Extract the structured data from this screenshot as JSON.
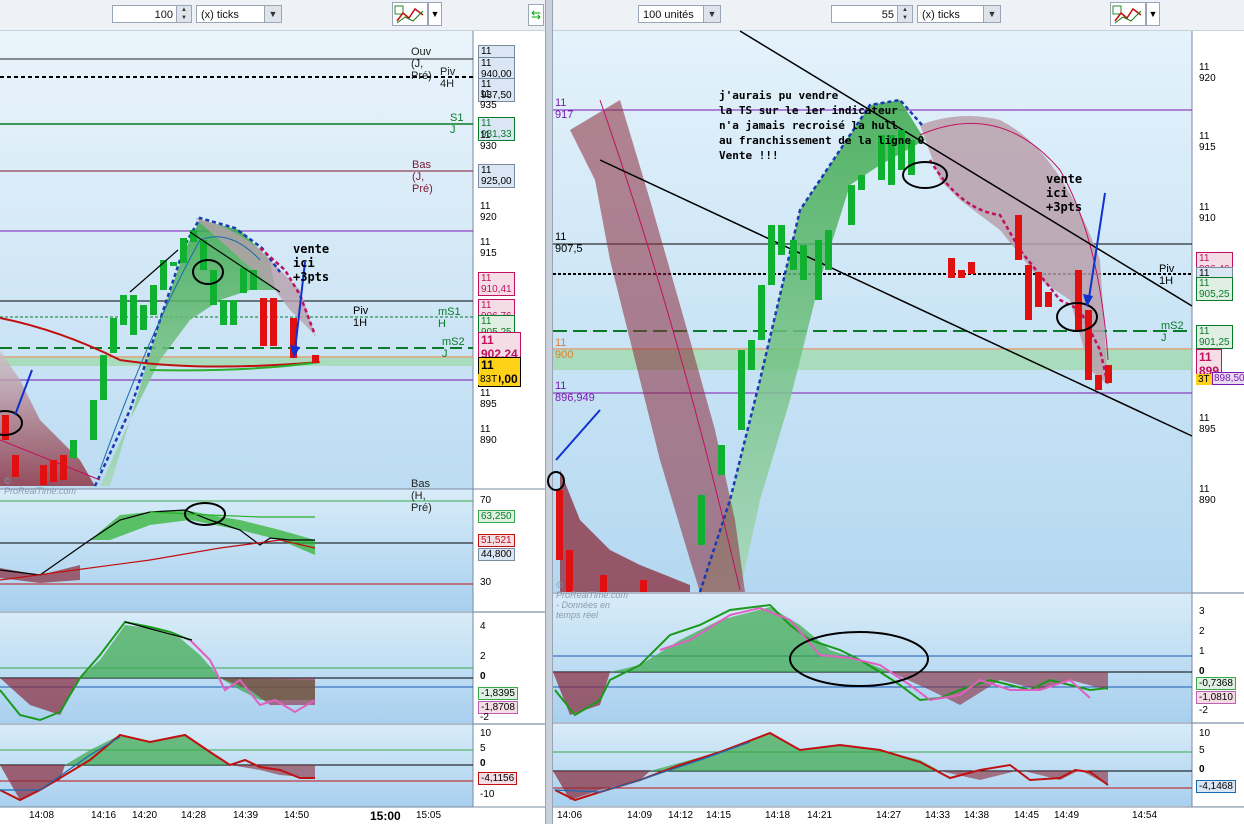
{
  "left_toolbar": {
    "quantity": "100",
    "unit": "(x) ticks"
  },
  "right_toolbar": {
    "units": "100 unités",
    "quantity": "55",
    "unit": "(x) ticks"
  },
  "left_chart": {
    "levels": [
      {
        "label": "Ouv (J, Pré)",
        "value": "11 940,00",
        "color": "#222"
      },
      {
        "label": "",
        "value": "11 940,00",
        "color": "#222"
      },
      {
        "label": "Piv 4H",
        "value": "11 937,50",
        "color": "#222"
      },
      {
        "label": "",
        "value": "11 937,50",
        "color": "#222"
      },
      {
        "label": "S1 J",
        "value": "11 931,33",
        "color": "#0a7a2a"
      },
      {
        "label": "Bas (J, Pré)",
        "value": "11 925,00",
        "color": "#7a1830"
      },
      {
        "label": "",
        "value": "11 910,41",
        "color": "#c01060"
      },
      {
        "label": "Piv 1H",
        "value": "11 906,76",
        "color": "#c01060"
      },
      {
        "label": "mS1 H",
        "value": "11 905,25",
        "color": "#0a7a2a"
      },
      {
        "label": "mS2 J",
        "value": "11 901,25",
        "color": "#0a7a2a"
      },
      {
        "label": "",
        "value": "11 902,24",
        "color": "#c01060"
      },
      {
        "label": "",
        "value": "11 899,00",
        "color": "#000"
      },
      {
        "label": "",
        "value": "83T",
        "color": "#000"
      },
      {
        "label": "Bas (H, Pré)",
        "value": "",
        "color": "#222"
      }
    ],
    "y_ticks": [
      "11 935",
      "11 930",
      "11 920",
      "11 915",
      "11 895",
      "11 890"
    ],
    "annotation": "vente ici +3pts",
    "ind1": {
      "ticks": [
        "70",
        "30"
      ],
      "values": [
        "63,250",
        "51,521",
        "44,800"
      ]
    },
    "ind2": {
      "ticks": [
        "4",
        "2",
        "0",
        "-2"
      ],
      "values": [
        "-1,8395",
        "-1,8708"
      ]
    },
    "ind3": {
      "ticks": [
        "10",
        "5",
        "0",
        "-5",
        "-10"
      ],
      "values": [
        "-4,1156"
      ]
    },
    "x_labels": [
      "14:08",
      "14:16",
      "14:20",
      "14:28",
      "14:39",
      "14:50",
      "15:00",
      "15:05"
    ],
    "watermark": "© ProRealTime.com"
  },
  "right_chart": {
    "annotation_top": "j'aurais pu vendre\nla TS sur le 1er indicateur\nn'a jamais recroisé la hull\nau franchissement de la ligne 0\nVente !!!",
    "annotation_right": "vente ici +3pts",
    "levels": [
      {
        "label": "11 917",
        "value": "",
        "color": "#7a1ab0"
      },
      {
        "label": "11 907,5",
        "value": "",
        "color": "#000"
      },
      {
        "label": "Piv 1H",
        "value": "11 906,46",
        "color": "#c01060"
      },
      {
        "label": "",
        "value": "11 905,33",
        "color": "#222"
      },
      {
        "label": "",
        "value": "11 905,25",
        "color": "#0a7a2a"
      },
      {
        "label": "mS2 J",
        "value": "11 901,25",
        "color": "#0a7a2a"
      },
      {
        "label": "11 900",
        "value": "11 899",
        "color": "#c01060"
      },
      {
        "label": "11 896,949",
        "value": "898,50",
        "color": "#7a1ab0"
      },
      {
        "label": "",
        "value": "3T",
        "color": "#000"
      }
    ],
    "y_ticks": [
      "11 920",
      "11 915",
      "11 910",
      "11 895",
      "11 890"
    ],
    "ind2": {
      "ticks": [
        "3",
        "2",
        "1",
        "0",
        "-1",
        "-2"
      ],
      "values": [
        "-0,7368",
        "-1,0810"
      ]
    },
    "ind3": {
      "ticks": [
        "10",
        "5",
        "0"
      ],
      "values": [
        "-4,1468"
      ]
    },
    "x_labels": [
      "14:06",
      "14:09",
      "14:12",
      "14:15",
      "14:18",
      "14:21",
      "14:27",
      "14:33",
      "14:38",
      "14:45",
      "14:49",
      "14:54"
    ],
    "watermark": "© ProRealTime.com - Données en temps réel"
  }
}
